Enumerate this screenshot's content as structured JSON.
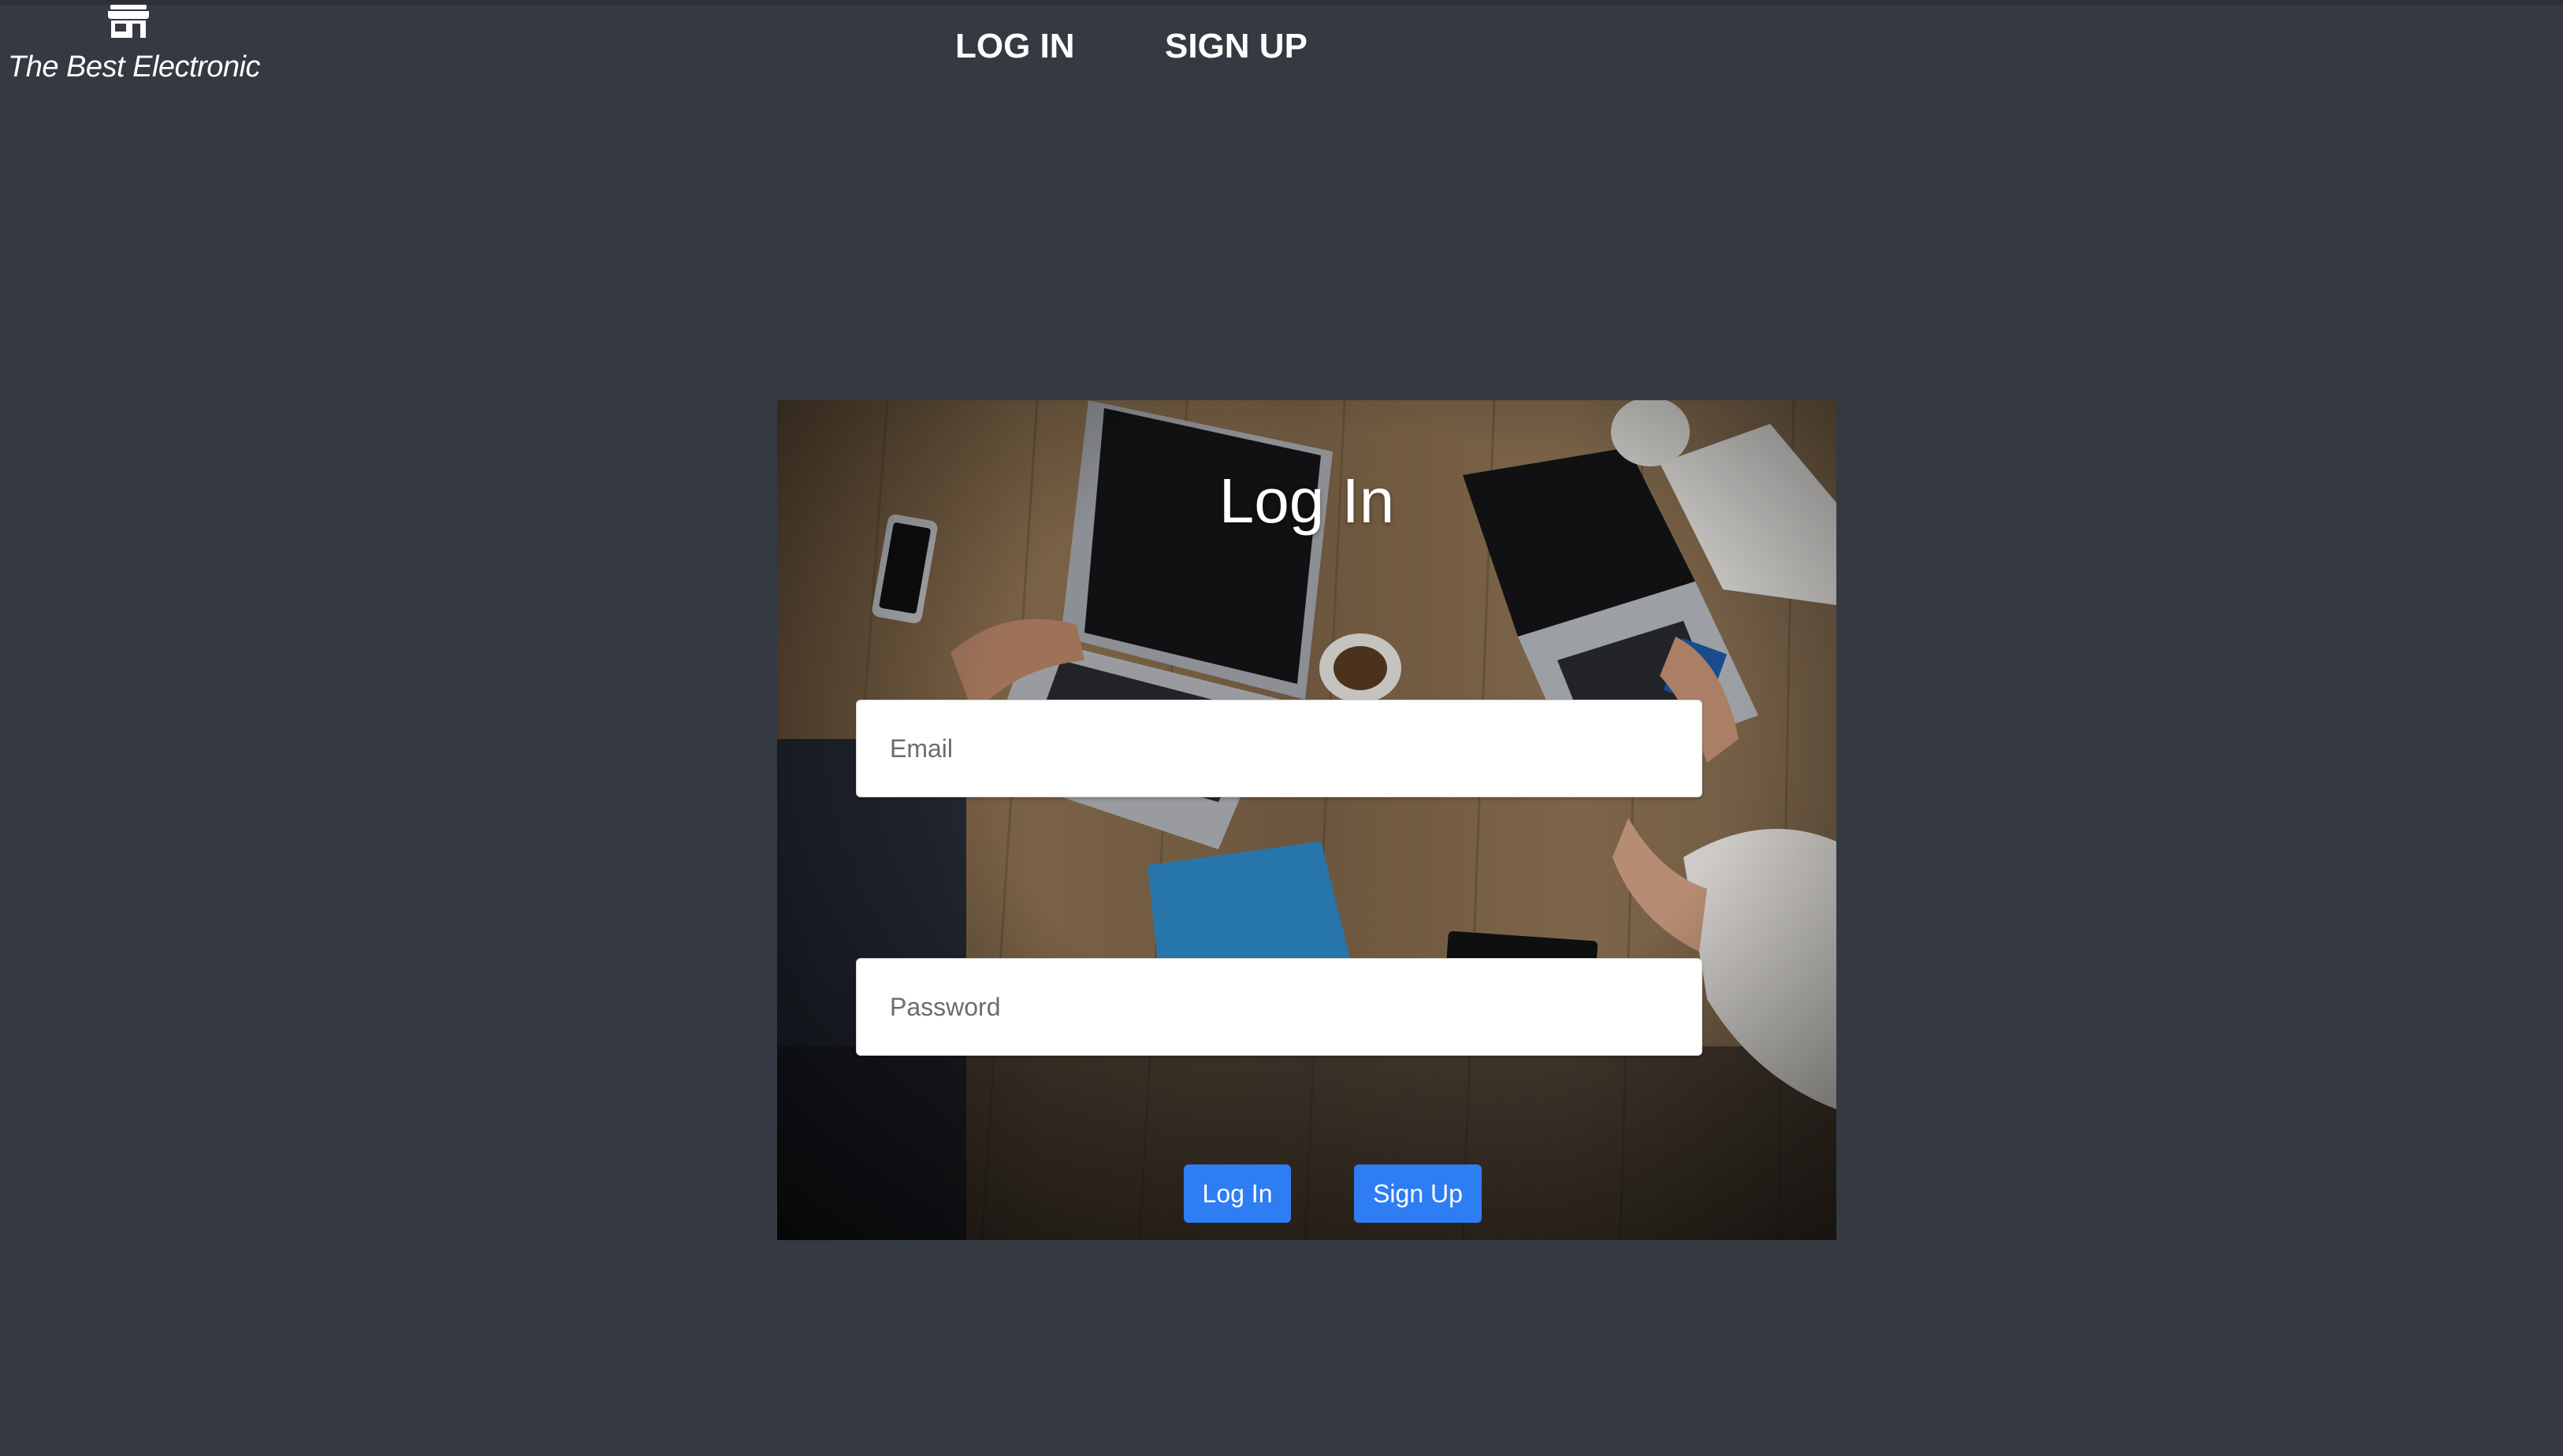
{
  "header": {
    "brand_name": "The Best Electronic",
    "brand_icon": "store-icon",
    "nav": [
      {
        "label": "LOG IN"
      },
      {
        "label": "SIGN UP"
      }
    ]
  },
  "login_card": {
    "title": "Log In",
    "email_placeholder": "Email",
    "password_placeholder": "Password",
    "login_button": "Log In",
    "signup_button": "Sign Up",
    "background_image": "overhead-office-desk-photo"
  },
  "colors": {
    "page_background": "#353941",
    "button_accent": "#2f7df3",
    "text": "#ffffff"
  }
}
